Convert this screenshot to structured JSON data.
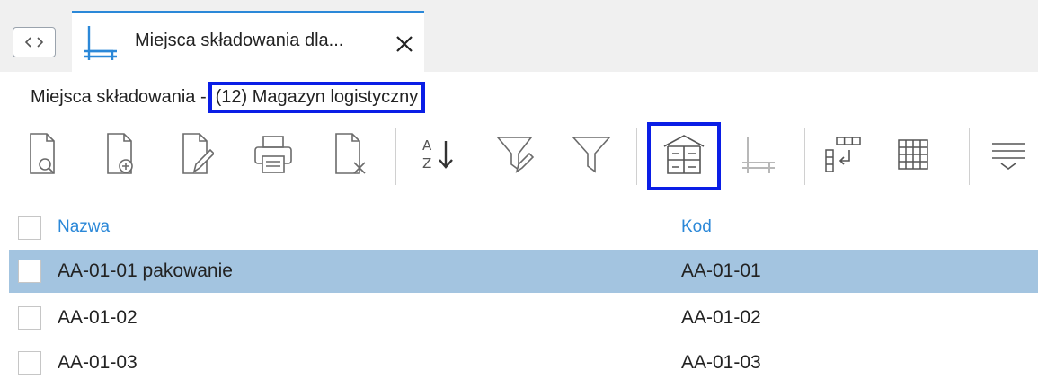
{
  "tab": {
    "title": "Miejsca składowania dla..."
  },
  "breadcrumb": {
    "prefix": "Miejsca składowania - ",
    "warehouse": "(12) Magazyn logistyczny"
  },
  "toolbar": {
    "buttons": [
      {
        "icon": "preview-document-icon"
      },
      {
        "icon": "add-document-icon"
      },
      {
        "icon": "edit-document-icon"
      },
      {
        "icon": "print-icon"
      },
      {
        "icon": "delete-document-icon"
      },
      {
        "icon": "sort-az-icon"
      },
      {
        "icon": "edit-filter-icon"
      },
      {
        "icon": "filter-icon"
      },
      {
        "icon": "warehouse-icon"
      },
      {
        "icon": "storage-rack-icon"
      },
      {
        "icon": "column-layout-icon"
      },
      {
        "icon": "grid-icon"
      },
      {
        "icon": "group-menu-icon"
      }
    ]
  },
  "grid": {
    "columns": [
      "Nazwa",
      "Kod"
    ],
    "rows": [
      {
        "name": "AA-01-01 pakowanie",
        "code": "AA-01-01",
        "selected": true
      },
      {
        "name": "AA-01-02",
        "code": "AA-01-02",
        "selected": false
      },
      {
        "name": "AA-01-03",
        "code": "AA-01-03",
        "selected": false
      }
    ]
  },
  "colors": {
    "accent": "#2b88d8",
    "highlight": "#0a1ee6",
    "selected_row": "#a3c4e0"
  }
}
